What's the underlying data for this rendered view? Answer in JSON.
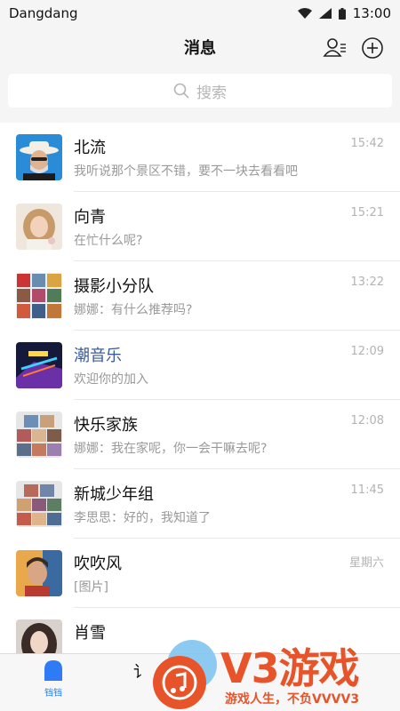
{
  "status_bar": {
    "carrier": "Dangdang",
    "time": "13:00"
  },
  "header": {
    "title": "消息"
  },
  "search": {
    "placeholder": "搜索"
  },
  "conversations": [
    {
      "name": "北流",
      "preview": "我听说那个景区不错，要不一块去看看吧",
      "time": "15:42",
      "name_color": "#111111"
    },
    {
      "name": "向青",
      "preview": "在忙什么呢?",
      "time": "15:21",
      "name_color": "#111111"
    },
    {
      "name": "摄影小分队",
      "preview": "娜娜：有什么推荐吗?",
      "time": "13:22",
      "name_color": "#111111"
    },
    {
      "name": "潮音乐",
      "preview": "欢迎你的加入",
      "time": "12:09",
      "name_color": "#3b5c9a"
    },
    {
      "name": "快乐家族",
      "preview": "娜娜：我在家呢，你一会干嘛去呢?",
      "time": "12:08",
      "name_color": "#111111"
    },
    {
      "name": "新城少年组",
      "preview": "李思思：好的，我知道了",
      "time": "11:45",
      "name_color": "#111111"
    },
    {
      "name": "吹吹风",
      "preview": "[图片]",
      "time": "星期六",
      "name_color": "#111111"
    },
    {
      "name": "肖雪",
      "preview": "",
      "time": "",
      "name_color": "#111111"
    }
  ],
  "tabbar": {
    "home_label": "铛铛",
    "partial_label": "讠"
  },
  "watermark": {
    "brand": "V3游戏",
    "slogan": "游戏人生，不负VVVV3"
  },
  "colors": {
    "accent": "#2f7bf6",
    "watermark": "#e8542a"
  }
}
